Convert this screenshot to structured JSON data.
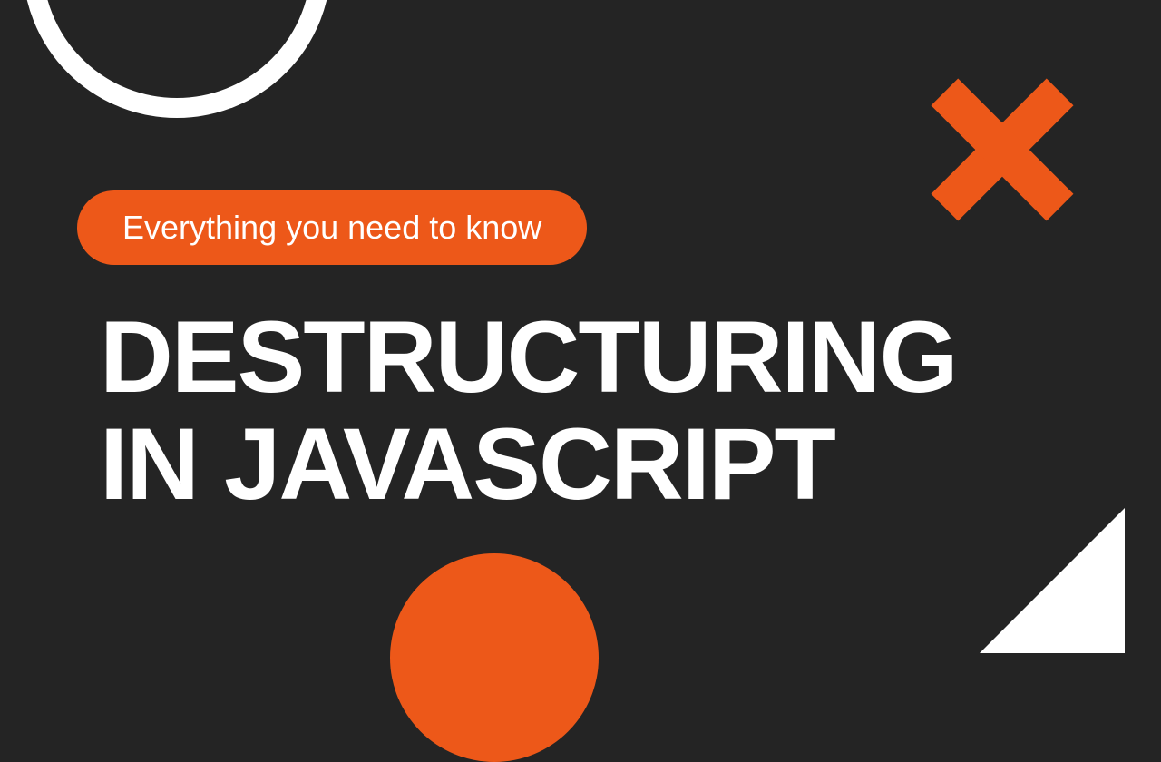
{
  "badge": {
    "text": "Everything you need to know"
  },
  "headline": {
    "line1": "DESTRUCTURING",
    "line2": "IN JAVASCRIPT"
  },
  "colors": {
    "background": "#242424",
    "accent": "#ed5819",
    "text": "#ffffff"
  }
}
